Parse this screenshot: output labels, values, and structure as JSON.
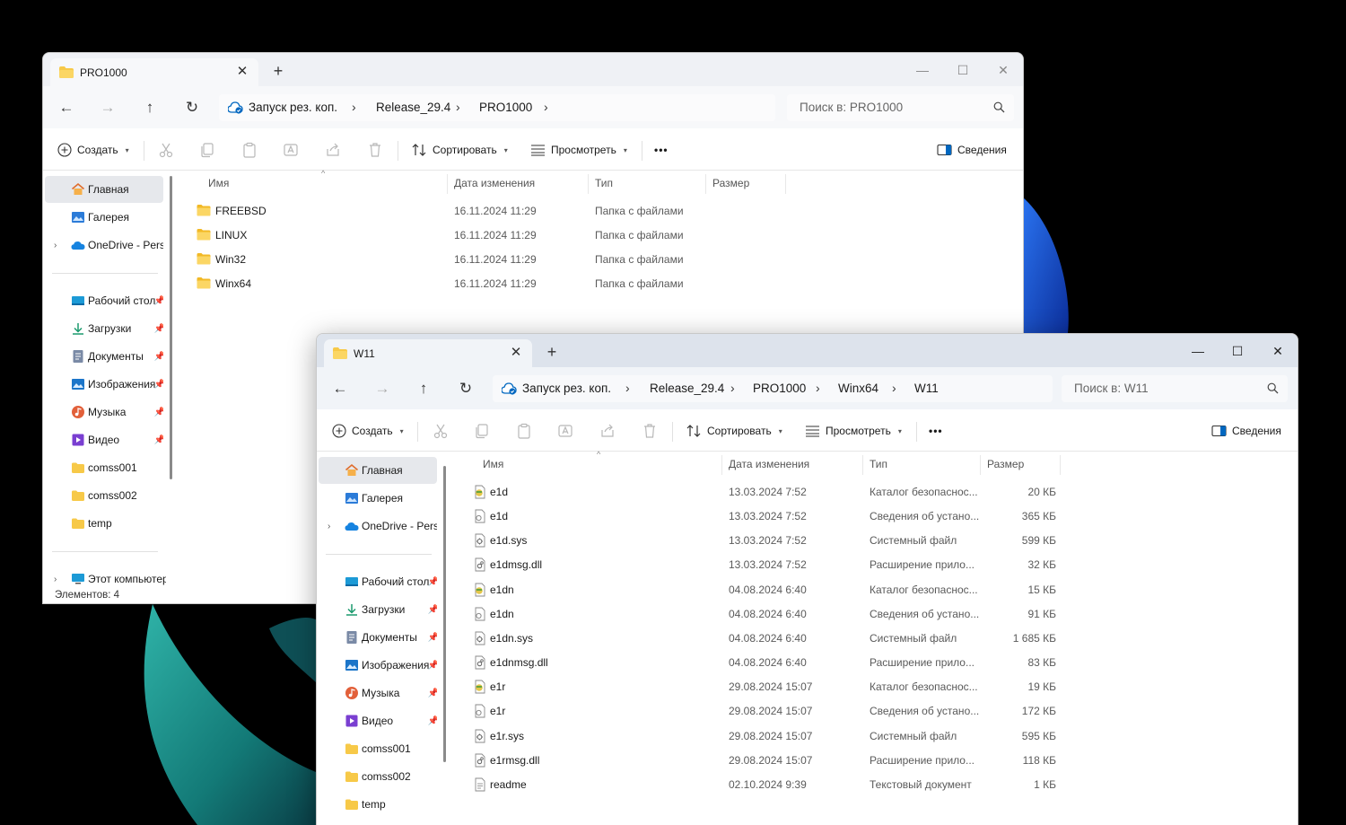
{
  "window1": {
    "tab_title": "PRO1000",
    "breadcrumb": [
      "Запуск рез. коп.",
      "Release_29.4",
      "PRO1000"
    ],
    "search_placeholder": "Поиск в: PRO1000",
    "status": "Элементов: 4",
    "files": [
      {
        "name": "FREEBSD",
        "date": "16.11.2024 11:29",
        "type": "Папка с файлами",
        "size": "",
        "icon": "folder-icon"
      },
      {
        "name": "LINUX",
        "date": "16.11.2024 11:29",
        "type": "Папка с файлами",
        "size": "",
        "icon": "folder-icon"
      },
      {
        "name": "Win32",
        "date": "16.11.2024 11:29",
        "type": "Папка с файлами",
        "size": "",
        "icon": "folder-icon"
      },
      {
        "name": "Winx64",
        "date": "16.11.2024 11:29",
        "type": "Папка с файлами",
        "size": "",
        "icon": "folder-icon"
      }
    ]
  },
  "window2": {
    "tab_title": "W11",
    "breadcrumb": [
      "Запуск рез. коп.",
      "Release_29.4",
      "PRO1000",
      "Winx64",
      "W11"
    ],
    "search_placeholder": "Поиск в: W11",
    "files": [
      {
        "name": "e1d",
        "date": "13.03.2024 7:52",
        "type": "Каталог безопаснос...",
        "size": "20 КБ",
        "icon": "security-catalog-icon"
      },
      {
        "name": "e1d",
        "date": "13.03.2024 7:52",
        "type": "Сведения об устано...",
        "size": "365 КБ",
        "icon": "setup-info-icon"
      },
      {
        "name": "e1d.sys",
        "date": "13.03.2024 7:52",
        "type": "Системный файл",
        "size": "599 КБ",
        "icon": "system-file-icon"
      },
      {
        "name": "e1dmsg.dll",
        "date": "13.03.2024 7:52",
        "type": "Расширение прило...",
        "size": "32 КБ",
        "icon": "dll-file-icon"
      },
      {
        "name": "e1dn",
        "date": "04.08.2024 6:40",
        "type": "Каталог безопаснос...",
        "size": "15 КБ",
        "icon": "security-catalog-icon"
      },
      {
        "name": "e1dn",
        "date": "04.08.2024 6:40",
        "type": "Сведения об устано...",
        "size": "91 КБ",
        "icon": "setup-info-icon"
      },
      {
        "name": "e1dn.sys",
        "date": "04.08.2024 6:40",
        "type": "Системный файл",
        "size": "1 685 КБ",
        "icon": "system-file-icon"
      },
      {
        "name": "e1dnmsg.dll",
        "date": "04.08.2024 6:40",
        "type": "Расширение прило...",
        "size": "83 КБ",
        "icon": "dll-file-icon"
      },
      {
        "name": "e1r",
        "date": "29.08.2024 15:07",
        "type": "Каталог безопаснос...",
        "size": "19 КБ",
        "icon": "security-catalog-icon"
      },
      {
        "name": "e1r",
        "date": "29.08.2024 15:07",
        "type": "Сведения об устано...",
        "size": "172 КБ",
        "icon": "setup-info-icon"
      },
      {
        "name": "e1r.sys",
        "date": "29.08.2024 15:07",
        "type": "Системный файл",
        "size": "595 КБ",
        "icon": "system-file-icon"
      },
      {
        "name": "e1rmsg.dll",
        "date": "29.08.2024 15:07",
        "type": "Расширение прило...",
        "size": "118 КБ",
        "icon": "dll-file-icon"
      },
      {
        "name": "readme",
        "date": "02.10.2024 9:39",
        "type": "Текстовый документ",
        "size": "1 КБ",
        "icon": "text-file-icon"
      }
    ]
  },
  "toolbar": {
    "create": "Создать",
    "sort": "Сортировать",
    "view": "Просмотреть",
    "more": "•••",
    "details": "Сведения"
  },
  "columns": {
    "name": "Имя",
    "date": "Дата изменения",
    "type": "Тип",
    "size": "Размер"
  },
  "sidebar": {
    "items": [
      {
        "label": "Главная",
        "icon": "home-icon"
      },
      {
        "label": "Галерея",
        "icon": "gallery-icon"
      },
      {
        "label": "OneDrive - Personal",
        "icon": "onedrive-icon"
      },
      {
        "label": "Рабочий стол",
        "icon": "desktop-icon"
      },
      {
        "label": "Загрузки",
        "icon": "downloads-icon"
      },
      {
        "label": "Документы",
        "icon": "documents-icon"
      },
      {
        "label": "Изображения",
        "icon": "pictures-icon"
      },
      {
        "label": "Музыка",
        "icon": "music-icon"
      },
      {
        "label": "Видео",
        "icon": "videos-icon"
      },
      {
        "label": "comss001",
        "icon": "folder-icon"
      },
      {
        "label": "comss002",
        "icon": "folder-icon"
      },
      {
        "label": "temp",
        "icon": "folder-icon"
      },
      {
        "label": "Этот компьютер",
        "icon": "this-pc-icon"
      }
    ]
  },
  "colors": {
    "accent": "#0067c0",
    "folder": "#f7c948",
    "wallpaper_teal": "#1d8f88",
    "wallpaper_blue": "#1f57d6"
  }
}
